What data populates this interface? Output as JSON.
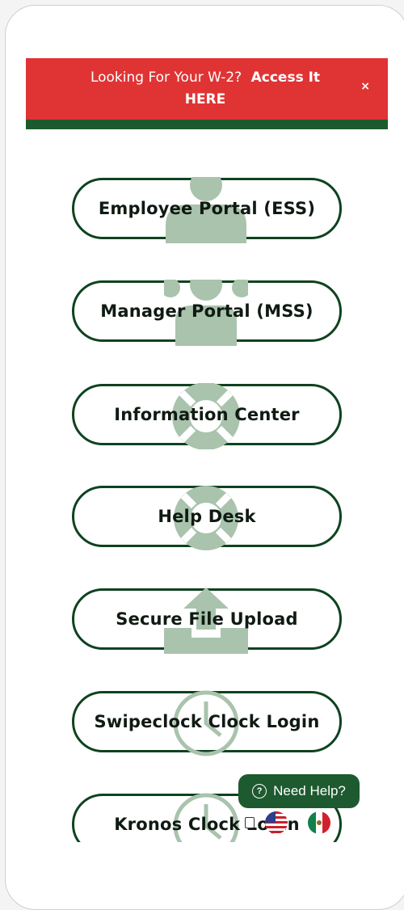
{
  "banner": {
    "lead": "Looking For Your W-2?",
    "link": "Access It HERE",
    "close": "×"
  },
  "buttons": [
    {
      "label": "Employee Portal (ESS)",
      "icon": "person-icon"
    },
    {
      "label": "Manager Portal (MSS)",
      "icon": "group-icon"
    },
    {
      "label": "Information Center",
      "icon": "lifebuoy-icon"
    },
    {
      "label": "Help Desk",
      "icon": "lifebuoy-icon"
    },
    {
      "label": "Secure File Upload",
      "icon": "upload-icon"
    },
    {
      "label": "Swipeclock Clock Login",
      "icon": "clock-icon"
    },
    {
      "label": "Kronos Clock Login",
      "icon": "clock-icon"
    }
  ],
  "help": {
    "label": "Need Help?",
    "icon": "question-circle-icon"
  },
  "language": {
    "flags": [
      "us-flag-icon",
      "mexico-flag-icon"
    ]
  },
  "colors": {
    "banner": "#e03434",
    "strip": "#1c5a2e",
    "border": "#0f4220",
    "icon": "#a9c3ad"
  }
}
